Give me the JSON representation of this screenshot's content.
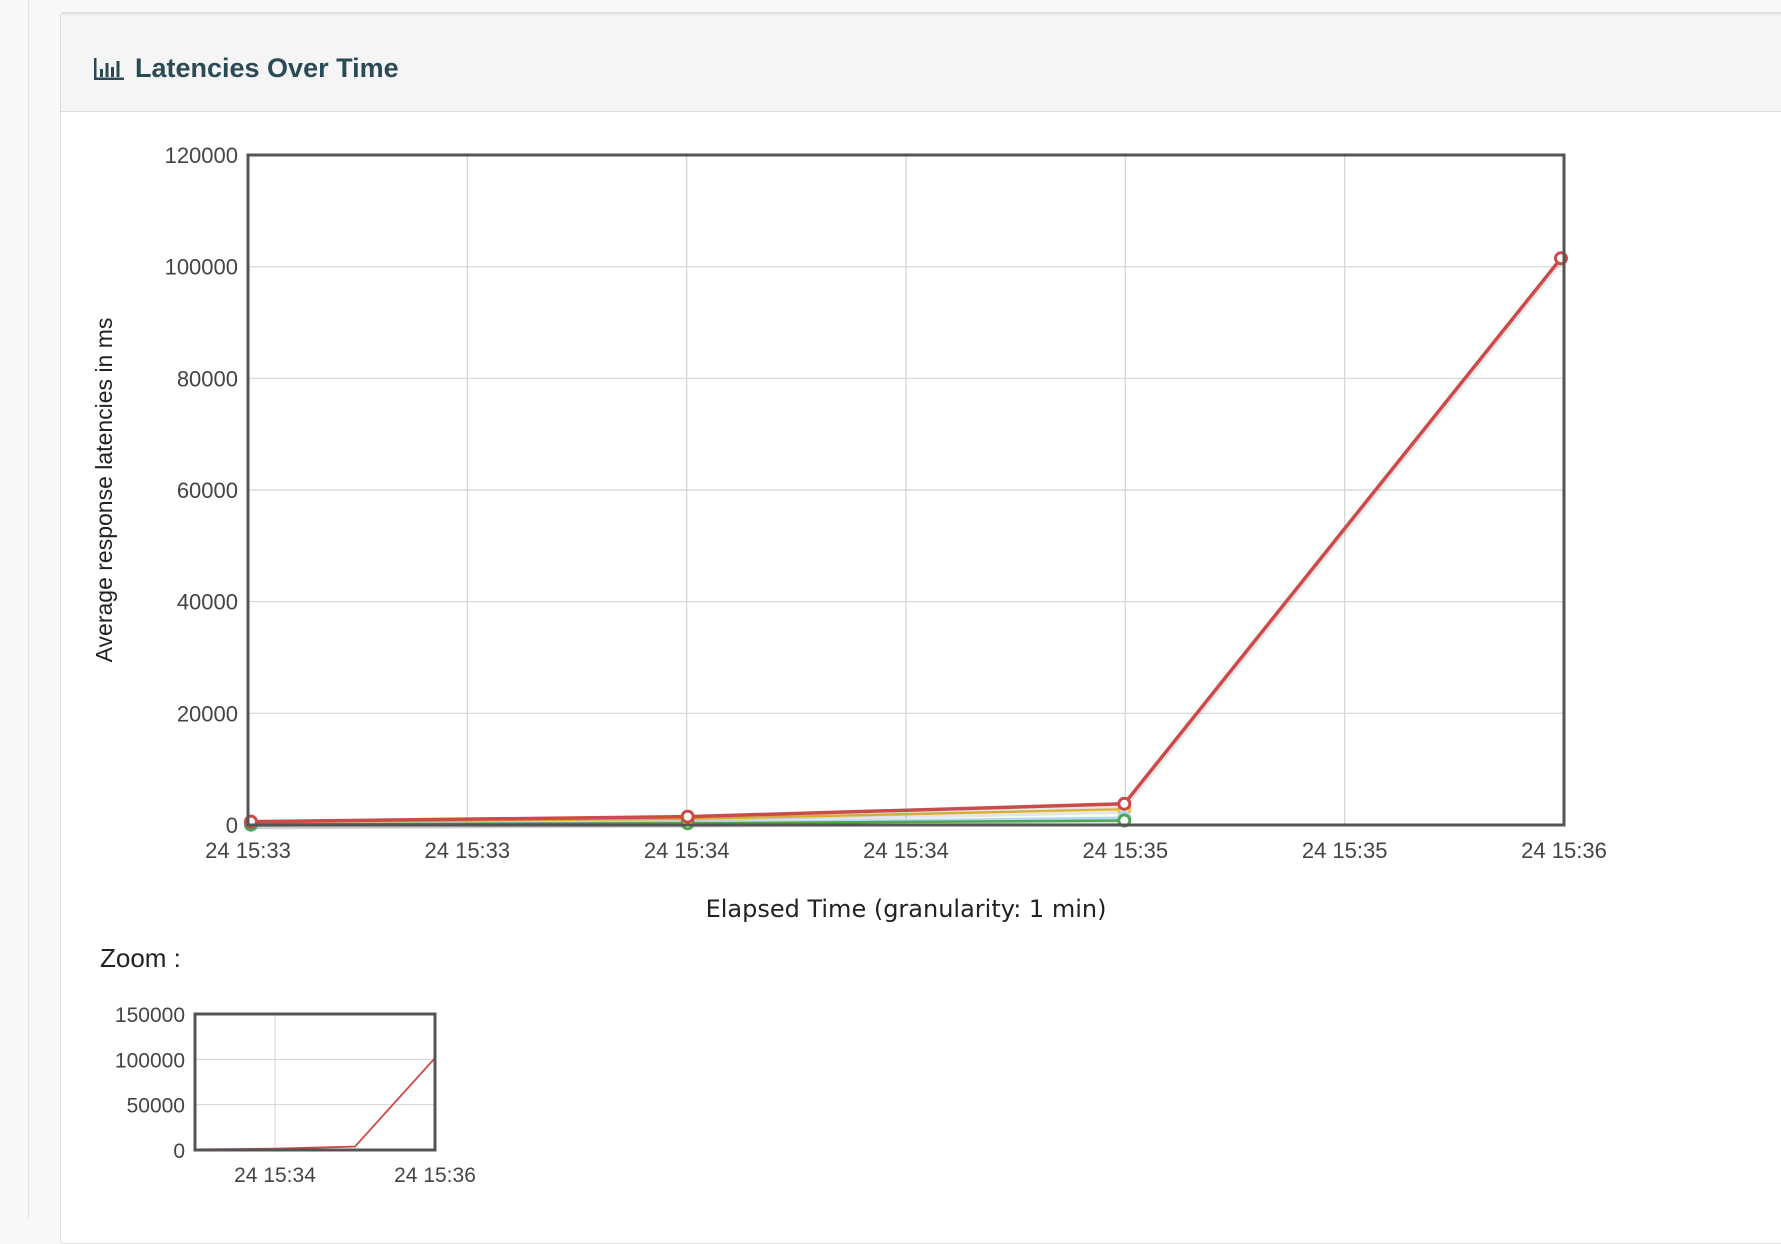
{
  "panel": {
    "title": "Latencies Over Time",
    "title_icon": "bar-chart-icon",
    "zoom_label": "Zoom :"
  },
  "colors": {
    "title": "#2a4a55",
    "series_red": "#cb4b4b",
    "series_orange": "#edc240",
    "series_blue": "#afd8f8",
    "frame": "#545454",
    "grid": "#d4d4d4"
  },
  "chart_data": [
    {
      "type": "line",
      "title": "",
      "xlabel": "Elapsed Time (granularity: 1 min)",
      "ylabel": "Average response latencies in ms",
      "grid": true,
      "x_tick_labels": [
        "24 15:33",
        "24 15:33",
        "24 15:34",
        "24 15:34",
        "24 15:35",
        "24 15:35",
        "24 15:36"
      ],
      "y_tick_labels": [
        "0",
        "20000",
        "40000",
        "60000",
        "80000",
        "100000",
        "120000"
      ],
      "ylim": [
        0,
        120000
      ],
      "x_points": [
        "24 15:33",
        "24 15:34",
        "24 15:35",
        "24 15:36"
      ],
      "series": [
        {
          "color": "#cb4b4b",
          "values": [
            600,
            1500,
            3800,
            101500
          ]
        },
        {
          "color": "#edc240",
          "values": [
            500,
            1100,
            2800,
            null
          ]
        },
        {
          "color": "#afd8f8",
          "values": [
            0,
            400,
            1300,
            null
          ]
        },
        {
          "color": "#4da74d",
          "values": [
            100,
            300,
            800,
            null
          ]
        }
      ]
    },
    {
      "type": "line",
      "title": "Zoom",
      "x_tick_labels": [
        "24 15:34",
        "24 15:36"
      ],
      "y_tick_labels": [
        "0",
        "50000",
        "100000",
        "150000"
      ],
      "ylim": [
        0,
        150000
      ],
      "grid": true,
      "series": [
        {
          "color": "#cb4b4b",
          "values": [
            600,
            1500,
            3800,
            101500
          ]
        }
      ]
    }
  ]
}
